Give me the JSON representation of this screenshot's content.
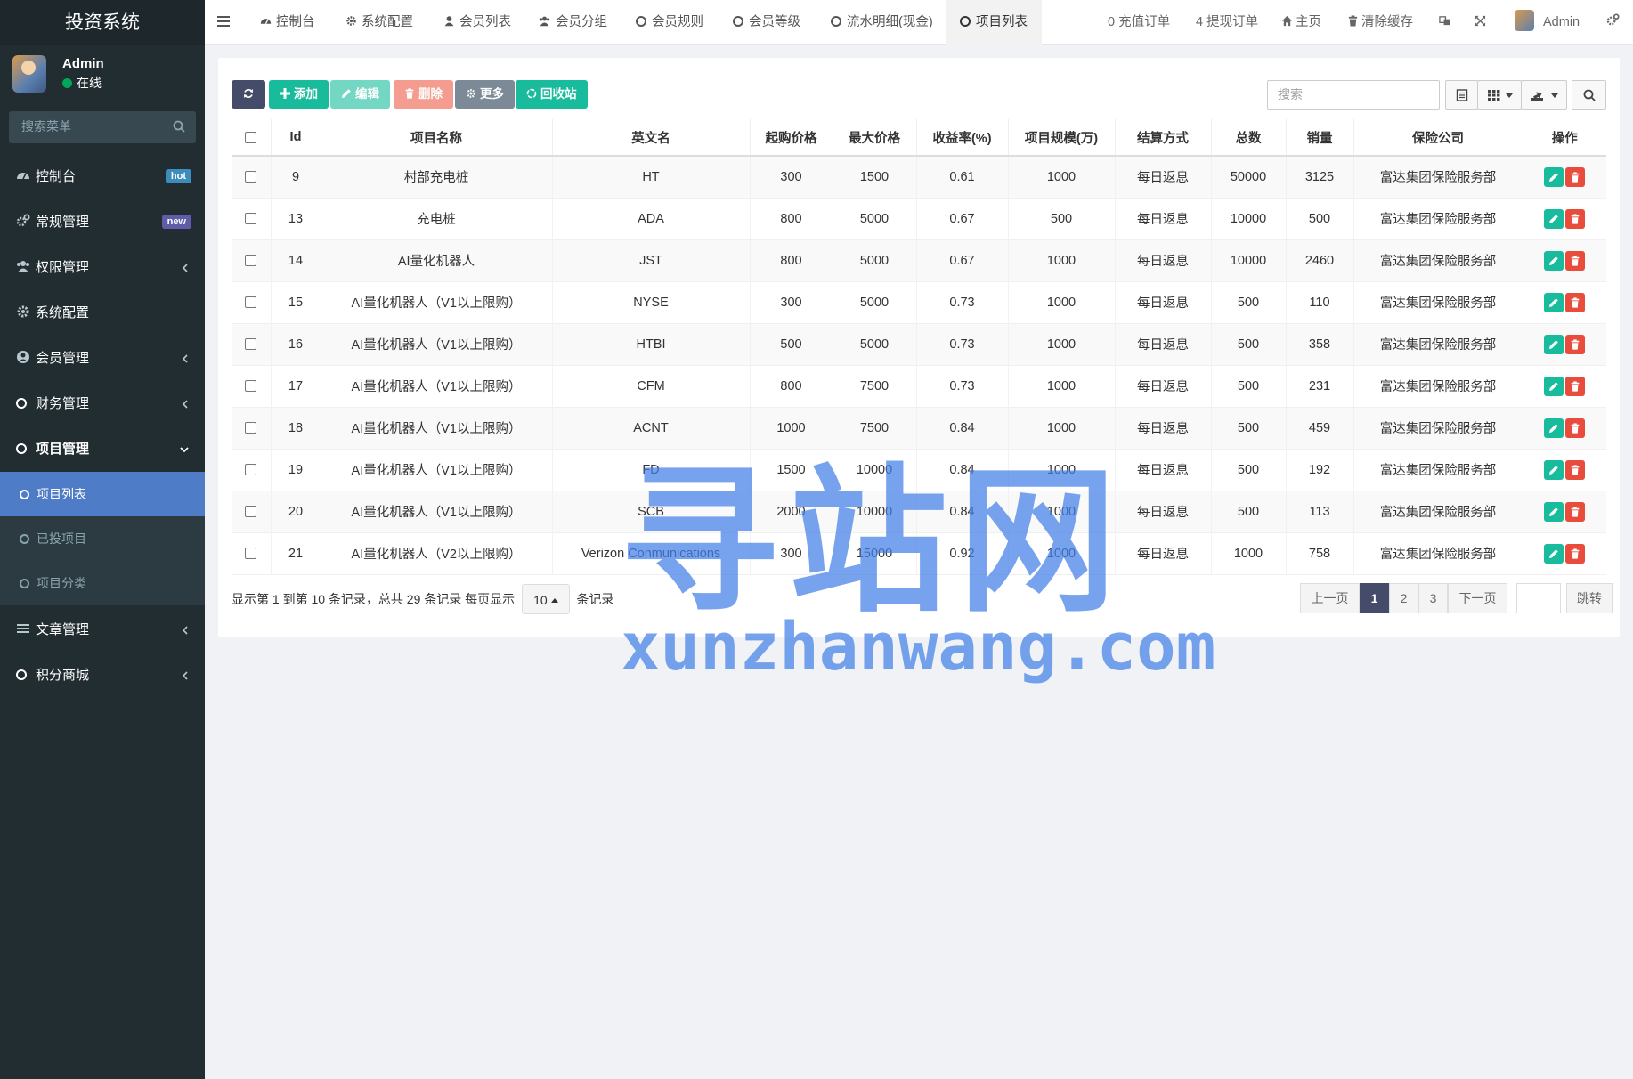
{
  "sidebar": {
    "brand": "投资系统",
    "user": {
      "name": "Admin",
      "status": "在线"
    },
    "search_placeholder": "搜索菜单",
    "items": [
      {
        "label": "控制台",
        "icon": "dashboard-icon",
        "badge": "hot"
      },
      {
        "label": "常规管理",
        "icon": "cogs-icon",
        "badge": "new"
      },
      {
        "label": "权限管理",
        "icon": "group-icon"
      },
      {
        "label": "系统配置",
        "icon": "gear-icon"
      },
      {
        "label": "会员管理",
        "icon": "user-circle-icon"
      },
      {
        "label": "财务管理",
        "icon": "circle-icon"
      },
      {
        "label": "项目管理",
        "icon": "circle-icon"
      }
    ],
    "sub_items": [
      {
        "label": "项目列表"
      },
      {
        "label": "已投项目"
      },
      {
        "label": "项目分类"
      }
    ],
    "items_after": [
      {
        "label": "文章管理",
        "icon": "list-icon"
      },
      {
        "label": "积分商城",
        "icon": "circle-icon"
      }
    ]
  },
  "topbar": {
    "tabs": [
      {
        "label": "控制台",
        "icon": "dashboard-icon"
      },
      {
        "label": "系统配置",
        "icon": "gear-icon"
      },
      {
        "label": "会员列表",
        "icon": "user-icon"
      },
      {
        "label": "会员分组",
        "icon": "group-icon"
      },
      {
        "label": "会员规则",
        "icon": "circle-icon"
      },
      {
        "label": "会员等级",
        "icon": "circle-icon"
      },
      {
        "label": "流水明细(现金)",
        "icon": "circle-icon"
      },
      {
        "label": "项目列表",
        "icon": "circle-icon"
      }
    ],
    "recharge_orders": "0 充值订单",
    "withdraw_orders": "4 提现订单",
    "home": "主页",
    "clear_cache": "清除缓存",
    "admin": "Admin"
  },
  "toolbar": {
    "add": "添加",
    "edit": "编辑",
    "delete": "删除",
    "more": "更多",
    "recycle": "回收站",
    "search_placeholder": "搜索"
  },
  "table": {
    "columns": [
      "Id",
      "项目名称",
      "英文名",
      "起购价格",
      "最大价格",
      "收益率(%)",
      "项目规模(万)",
      "结算方式",
      "总数",
      "销量",
      "保险公司",
      "操作"
    ],
    "rows": [
      [
        "9",
        "村部充电桩",
        "HT",
        "300",
        "1500",
        "0.61",
        "1000",
        "每日返息",
        "50000",
        "3125",
        "富达集团保险服务部"
      ],
      [
        "13",
        "充电桩",
        "ADA",
        "800",
        "5000",
        "0.67",
        "500",
        "每日返息",
        "10000",
        "500",
        "富达集团保险服务部"
      ],
      [
        "14",
        "AI量化机器人",
        "JST",
        "800",
        "5000",
        "0.67",
        "1000",
        "每日返息",
        "10000",
        "2460",
        "富达集团保险服务部"
      ],
      [
        "15",
        "AI量化机器人（V1以上限购）",
        "NYSE",
        "300",
        "5000",
        "0.73",
        "1000",
        "每日返息",
        "500",
        "110",
        "富达集团保险服务部"
      ],
      [
        "16",
        "AI量化机器人（V1以上限购）",
        "HTBI",
        "500",
        "5000",
        "0.73",
        "1000",
        "每日返息",
        "500",
        "358",
        "富达集团保险服务部"
      ],
      [
        "17",
        "AI量化机器人（V1以上限购）",
        "CFM",
        "800",
        "7500",
        "0.73",
        "1000",
        "每日返息",
        "500",
        "231",
        "富达集团保险服务部"
      ],
      [
        "18",
        "AI量化机器人（V1以上限购）",
        "ACNT",
        "1000",
        "7500",
        "0.84",
        "1000",
        "每日返息",
        "500",
        "459",
        "富达集团保险服务部"
      ],
      [
        "19",
        "AI量化机器人（V1以上限购）",
        "FD",
        "1500",
        "10000",
        "0.84",
        "1000",
        "每日返息",
        "500",
        "192",
        "富达集团保险服务部"
      ],
      [
        "20",
        "AI量化机器人（V1以上限购）",
        "SCB",
        "2000",
        "10000",
        "0.84",
        "1000",
        "每日返息",
        "500",
        "113",
        "富达集团保险服务部"
      ],
      [
        "21",
        "AI量化机器人（V2以上限购）",
        "Verizon Conmunications",
        "300",
        "15000",
        "0.92",
        "1000",
        "每日返息",
        "1000",
        "758",
        "富达集团保险服务部"
      ]
    ]
  },
  "pagination": {
    "info_prefix": "显示第 1 到第 10 条记录，总共 29 条记录 每页显示",
    "page_size": "10",
    "info_suffix": "条记录",
    "prev": "上一页",
    "pages": [
      "1",
      "2",
      "3"
    ],
    "next": "下一页",
    "jump": "跳转"
  },
  "watermark": {
    "text_cn": "寻站网",
    "text_en": "xunzhanwang.com"
  },
  "colors": {
    "sidebar_bg": "#222d32",
    "active_menu": "#4f7cc6",
    "primary_dark": "#444c69",
    "success": "#18bc9c",
    "danger": "#e74c3c"
  }
}
